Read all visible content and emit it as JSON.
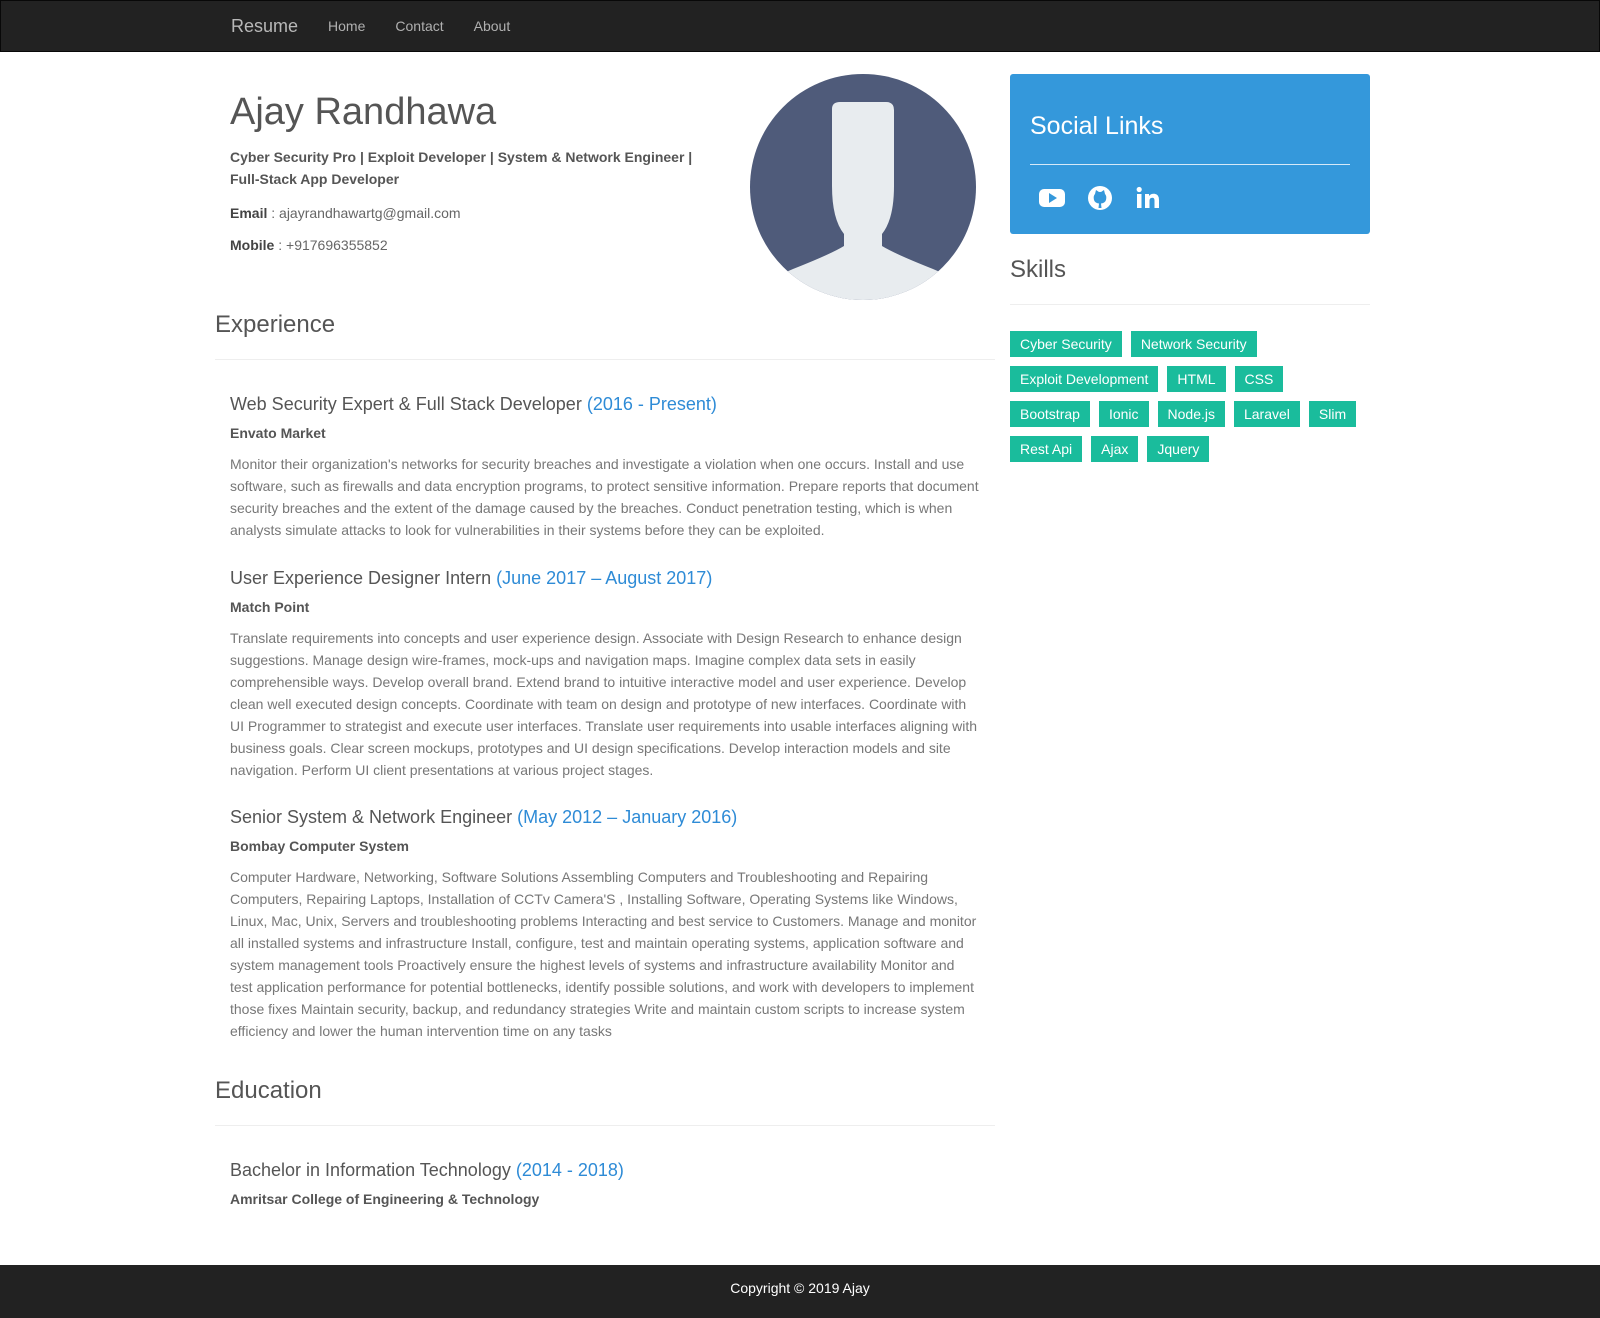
{
  "nav": {
    "brand": "Resume",
    "links": [
      "Home",
      "Contact",
      "About"
    ]
  },
  "profile": {
    "name": "Ajay Randhawa",
    "tagline_line1": "Cyber Security Pro | Exploit Developer | System & Network Engineer |",
    "tagline_line2": "Full-Stack App Developer",
    "email_label": "Email",
    "email": " : ajayrandhawartg@gmail.com",
    "mobile_label": "Mobile",
    "mobile": " : +917696355852",
    "avatar_icon": "user-avatar-icon"
  },
  "experience": {
    "title": "Experience",
    "jobs": [
      {
        "title": "Web Security Expert & Full Stack Developer",
        "date": "(2016 - Present)",
        "company": "Envato Market",
        "desc": "Monitor their organization's networks for security breaches and investigate a violation when one occurs. Install and use software, such as firewalls and data encryption programs, to protect sensitive information. Prepare reports that document security breaches and the extent of the damage caused by the breaches. Conduct penetration testing, which is when analysts simulate attacks to look for vulnerabilities in their systems before they can be exploited."
      },
      {
        "title": "User Experience Designer Intern",
        "date": "(June 2017 – August 2017)",
        "company": "Match Point",
        "desc": "Translate requirements into concepts and user experience design. Associate with Design Research to enhance design suggestions. Manage design wire-frames, mock-ups and navigation maps. Imagine complex data sets in easily comprehensible ways. Develop overall brand. Extend brand to intuitive interactive model and user experience. Develop clean well executed design concepts. Coordinate with team on design and prototype of new interfaces. Coordinate with UI Programmer to strategist and execute user interfaces. Translate user requirements into usable interfaces aligning with business goals. Clear screen mockups, prototypes and UI design specifications. Develop interaction models and site navigation. Perform UI client presentations at various project stages."
      },
      {
        "title": "Senior System & Network Engineer",
        "date": "(May 2012 – January 2016)",
        "company": "Bombay Computer System",
        "desc": "Computer Hardware, Networking, Software Solutions Assembling Computers and Troubleshooting and Repairing Computers, Repairing Laptops, Installation of CCTv Camera'S , Installing Software, Operating Systems like Windows, Linux, Mac, Unix, Servers and troubleshooting problems Interacting and best service to Customers. Manage and monitor all installed systems and infrastructure Install, configure, test and maintain operating systems, application software and system management tools Proactively ensure the highest levels of systems and infrastructure availability Monitor and test application performance for potential bottlenecks, identify possible solutions, and work with developers to implement those fixes Maintain security, backup, and redundancy strategies Write and maintain custom scripts to increase system efficiency and lower the human intervention time on any tasks"
      }
    ]
  },
  "education": {
    "title": "Education",
    "items": [
      {
        "title": "Bachelor in Information Technology",
        "date": "(2014 - 2018)",
        "school": "Amritsar College of Engineering & Technology"
      }
    ]
  },
  "social": {
    "title": "Social Links",
    "icons": [
      "youtube-icon",
      "github-icon",
      "linkedin-icon"
    ]
  },
  "skills": {
    "title": "Skills",
    "items": [
      "Cyber Security",
      "Network Security",
      "Exploit Development",
      "HTML",
      "CSS",
      "Bootstrap",
      "Ionic",
      "Node.js",
      "Laravel",
      "Slim",
      "Rest Api",
      "Ajax",
      "Jquery"
    ]
  },
  "footer": {
    "text": "Copyright © 2019 Ajay"
  },
  "colors": {
    "navbar": "#222222",
    "social_panel": "#3498db",
    "skill_badge": "#1abc9c",
    "date_accent": "#2e8bd6",
    "avatar_bg": "#4f5b7a"
  }
}
